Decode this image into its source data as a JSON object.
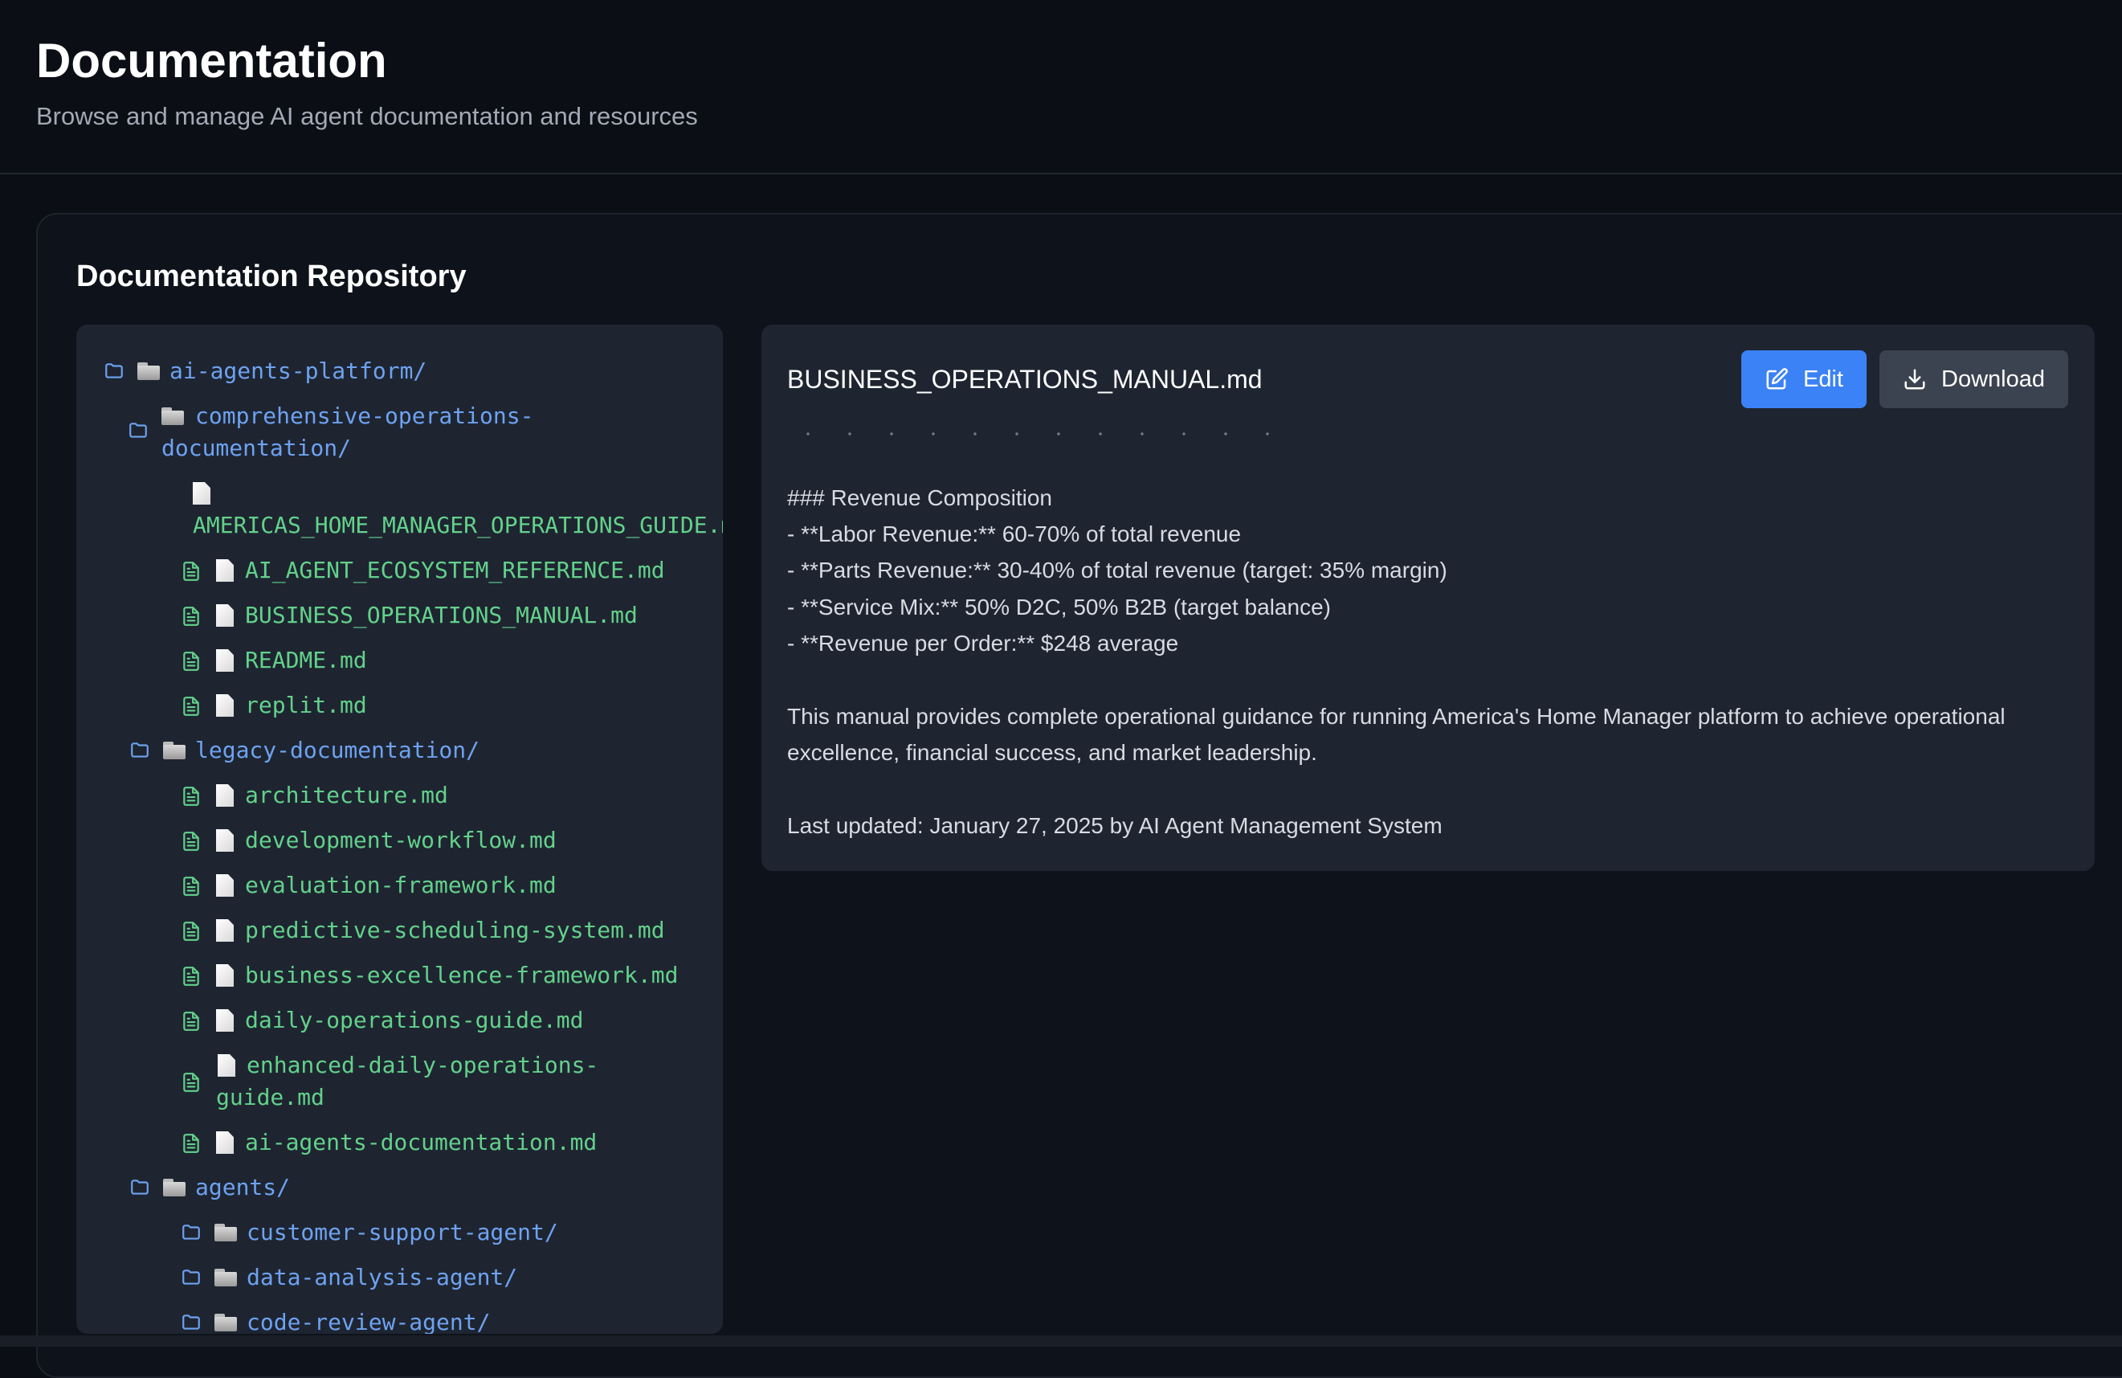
{
  "header": {
    "title": "Documentation",
    "subtitle": "Browse and manage AI agent documentation and resources"
  },
  "repository": {
    "title": "Documentation Repository"
  },
  "tree": {
    "root": "ai-agents-platform/",
    "comprehensive_folder": "comprehensive-operations-\ndocumentation/",
    "comprehensive_files": [
      "AMERICAS_HOME_MANAGER_OPERATIONS_GUIDE.md",
      "AI_AGENT_ECOSYSTEM_REFERENCE.md",
      "BUSINESS_OPERATIONS_MANUAL.md",
      "README.md",
      "replit.md"
    ],
    "legacy_folder": "legacy-documentation/",
    "legacy_files": [
      "architecture.md",
      "development-workflow.md",
      "evaluation-framework.md",
      "predictive-scheduling-system.md",
      "business-excellence-framework.md",
      "daily-operations-guide.md",
      "enhanced-daily-operations-\nguide.md",
      "ai-agents-documentation.md"
    ],
    "agents_folder": "agents/",
    "agent_folders": [
      "customer-support-agent/",
      "data-analysis-agent/",
      "code-review-agent/"
    ]
  },
  "document": {
    "filename": "BUSINESS_OPERATIONS_MANUAL.md",
    "edit_label": "Edit",
    "download_label": "Download",
    "lines": [
      "### Revenue Composition",
      "- **Labor Revenue:** 60-70% of total revenue",
      "- **Parts Revenue:** 30-40% of total revenue (target: 35% margin)",
      "- **Service Mix:** 50% D2C, 50% B2B (target balance)",
      "- **Revenue per Order:** $248 average",
      "This manual provides complete operational guidance for running America's Home Manager platform to achieve operational",
      "excellence, financial success, and market leadership.",
      "Last updated: January 27, 2025 by AI Agent Management System"
    ]
  },
  "colors": {
    "background": "#0b0e15",
    "panel": "#1e2531",
    "folder_text": "#6ea2f0",
    "file_text": "#63d18a",
    "primary_button": "#3b82f6",
    "secondary_button": "#3c4350"
  }
}
